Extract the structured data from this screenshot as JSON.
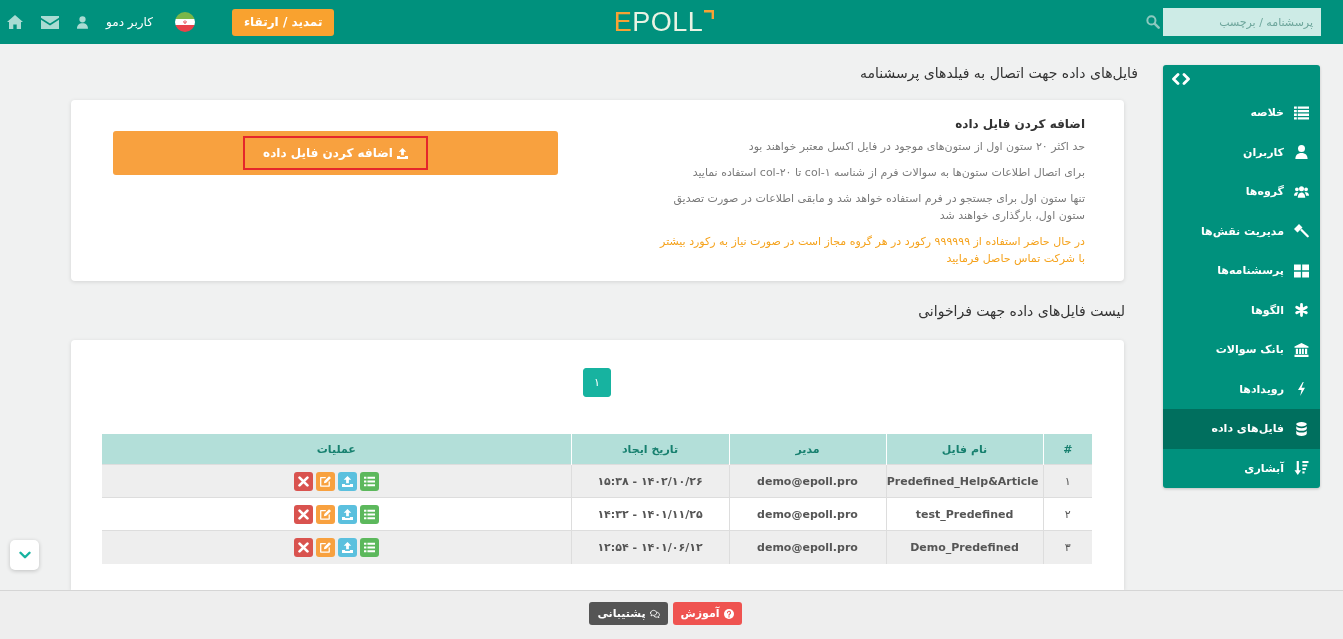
{
  "header": {
    "search": {
      "placeholder": "پرسشنامه / برچسب"
    },
    "logo": "EPOLL",
    "upgrade_button": "تمدید / ارتقاء",
    "user_name": "کاربر دمو"
  },
  "sidebar": {
    "items": [
      {
        "label": "خلاصه",
        "selected": false
      },
      {
        "label": "کاربران",
        "selected": false
      },
      {
        "label": "گروه‌ها",
        "selected": false
      },
      {
        "label": "مدیریت نقش‌ها",
        "selected": false
      },
      {
        "label": "پرسشنامه‌ها",
        "selected": false
      },
      {
        "label": "الگوها",
        "selected": false
      },
      {
        "label": "بانک سوالات",
        "selected": false
      },
      {
        "label": "رویدادها",
        "selected": false
      },
      {
        "label": "فایل‌های داده",
        "selected": true
      },
      {
        "label": "آبشاری",
        "selected": false
      }
    ]
  },
  "page_title": "فایل‌های داده جهت اتصال به فیلدهای پرسشنامه",
  "add_card": {
    "heading": "اضافه کردن فایل داده",
    "notes": [
      {
        "kind": "info",
        "text": "حد اکثر ۲۰ ستون اول از ستون‌های موجود در فایل اکسل معتبر خواهند بود"
      },
      {
        "kind": "info",
        "text": "برای اتصال اطلاعات ستون‌ها به سوالات فرم از شناسه col-۱ تا col-۲۰ استفاده نمایید"
      },
      {
        "kind": "info",
        "text": "تنها ستون اول برای جستجو در فرم استفاده خواهد شد و مابقی اطلاعات در صورت تصدیق ستون اول، بارگذاری خواهند شد"
      },
      {
        "kind": "warning",
        "text": "در حال حاضر استفاده از ۹۹۹۹۹۹ رکورد در هر گروه مجاز است در صورت نیاز به رکورد بیشتر با شرکت تماس حاصل فرمایید"
      }
    ],
    "button": {
      "label": "اضافه کردن فایل داده",
      "highlighted": true
    }
  },
  "list_title": "لیست فایل‌های داده جهت فراخوانی",
  "list_card": {
    "pagination": [
      {
        "label": "۱",
        "selected": true
      }
    ],
    "table": {
      "columns": [
        "#",
        "نام فایل",
        "مدیر",
        "تاریخ ایجاد",
        "عملیات"
      ],
      "rows": [
        [
          "۱",
          "Predefined_Help&Article",
          "demo@epoll.pro",
          "۱۴۰۲/۱۰/۲۶ - ۱۵:۳۸"
        ],
        [
          "۲",
          "test_Predefined",
          "demo@epoll.pro",
          "۱۴۰۱/۱۱/۲۵ - ۱۴:۳۲"
        ],
        [
          "۳",
          "Demo_Predefined",
          "demo@epoll.pro",
          "۱۴۰۱/۰۶/۱۲ - ۱۲:۵۴"
        ]
      ]
    }
  },
  "footer": {
    "buttons": [
      {
        "kind": "help",
        "label": "آموزش"
      },
      {
        "kind": "support",
        "label": "پشتیبانی"
      }
    ]
  }
}
